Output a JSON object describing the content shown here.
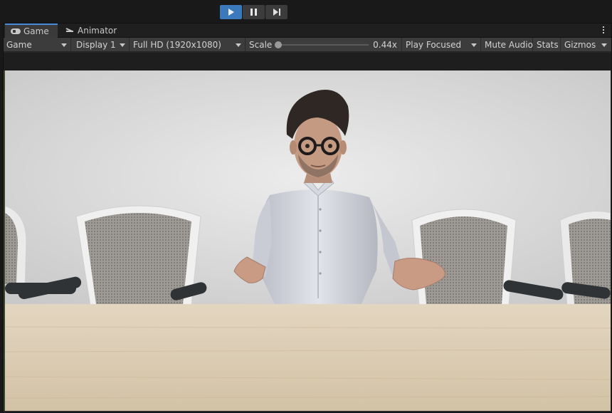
{
  "toolbar": {
    "play_label": "Play",
    "pause_label": "Pause",
    "step_label": "Step"
  },
  "tabs": [
    {
      "label": "Game",
      "icon": "gamepad-icon",
      "active": true
    },
    {
      "label": "Animator",
      "icon": "animator-icon",
      "active": false
    }
  ],
  "options": {
    "view_mode": "Game",
    "display": "Display 1",
    "resolution": "Full HD (1920x1080)",
    "scale_label": "Scale",
    "scale_value": "0.44x",
    "scale_fraction": 0.0,
    "play_mode": "Play Focused",
    "mute_audio": "Mute Audio",
    "stats": "Stats",
    "gizmos": "Gizmos"
  },
  "colors": {
    "play_accent": "#3a79bb",
    "tab_highlight": "#4a8adb",
    "panel_bg": "#3c3c3c"
  }
}
